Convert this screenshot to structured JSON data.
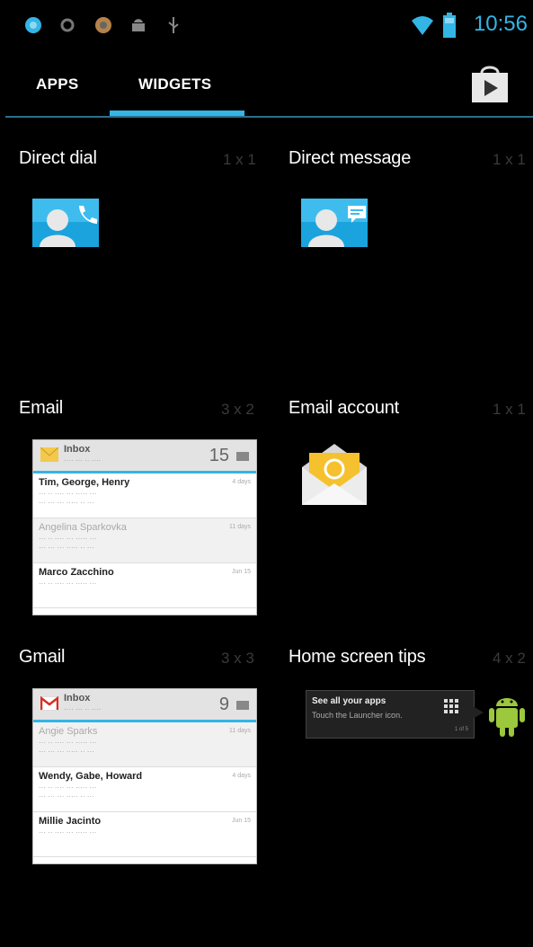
{
  "status_bar": {
    "time": "10:56",
    "icons": [
      "globe-icon",
      "notification-dot-icon",
      "chrome-icon",
      "android-debug-icon",
      "usb-icon",
      "wifi-icon",
      "battery-icon"
    ]
  },
  "tabs": [
    {
      "label": "APPS",
      "selected": false
    },
    {
      "label": "WIDGETS",
      "selected": true
    }
  ],
  "accent_color": "#33b5e5",
  "widgets": [
    {
      "title": "Direct dial",
      "size": "1 x 1",
      "preview": "direct-dial-icon"
    },
    {
      "title": "Direct message",
      "size": "1 x 1",
      "preview": "direct-message-icon"
    },
    {
      "title": "Email",
      "size": "3 x 2",
      "preview": "email-widget-preview"
    },
    {
      "title": "Email account",
      "size": "1 x 1",
      "preview": "email-account-icon"
    },
    {
      "title": "Gmail",
      "size": "3 x 3",
      "preview": "gmail-widget-preview"
    },
    {
      "title": "Home screen tips",
      "size": "4 x 2",
      "preview": "home-screen-tips-preview"
    }
  ],
  "email_preview": {
    "header": "Inbox",
    "count": "15",
    "rows": [
      {
        "from": "Tim, George, Henry",
        "time": "4 days",
        "read": false
      },
      {
        "from": "Angelina Sparkovka",
        "time": "11 days",
        "read": true
      },
      {
        "from": "Marco Zacchino",
        "time": "Jun 15",
        "read": false
      }
    ]
  },
  "gmail_preview": {
    "header": "Inbox",
    "count": "9",
    "rows": [
      {
        "from": "Angie Sparks",
        "time": "11 days",
        "read": true
      },
      {
        "from": "Wendy, Gabe, Howard",
        "time": "4 days",
        "read": false
      },
      {
        "from": "Millie Jacinto",
        "time": "Jun 15",
        "read": false
      }
    ]
  },
  "tips_preview": {
    "title": "See all your apps",
    "text": "Touch the Launcher icon.",
    "page": "1 of 5"
  }
}
